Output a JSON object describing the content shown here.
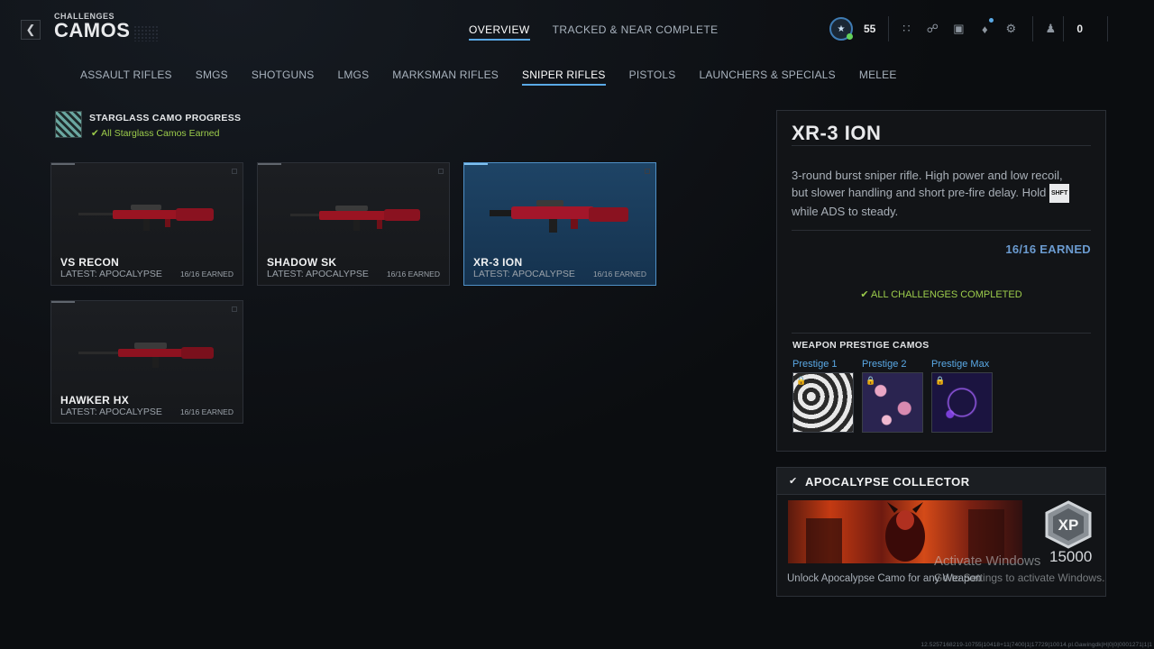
{
  "header": {
    "subtitle": "CHALLENGES",
    "title": "CAMOS",
    "tabs": [
      {
        "label": "OVERVIEW",
        "active": true
      },
      {
        "label": "TRACKED & NEAR COMPLETE",
        "active": false
      }
    ],
    "rank_level": "55",
    "currency_count": "0"
  },
  "categories": [
    {
      "label": "ASSAULT RIFLES",
      "active": false
    },
    {
      "label": "SMGS",
      "active": false
    },
    {
      "label": "SHOTGUNS",
      "active": false
    },
    {
      "label": "LMGS",
      "active": false
    },
    {
      "label": "MARKSMAN RIFLES",
      "active": false
    },
    {
      "label": "SNIPER RIFLES",
      "active": true
    },
    {
      "label": "PISTOLS",
      "active": false
    },
    {
      "label": "LAUNCHERS & SPECIALS",
      "active": false
    },
    {
      "label": "MELEE",
      "active": false
    }
  ],
  "starglass": {
    "title": "STARGLASS CAMO PROGRESS",
    "status": "All Starglass Camos Earned"
  },
  "weapons": [
    {
      "name": "VS RECON",
      "latest": "LATEST: APOCALYPSE",
      "earned": "16/16 EARNED",
      "selected": false
    },
    {
      "name": "SHADOW SK",
      "latest": "LATEST: APOCALYPSE",
      "earned": "16/16 EARNED",
      "selected": false
    },
    {
      "name": "XR-3 ION",
      "latest": "LATEST: APOCALYPSE",
      "earned": "16/16 EARNED",
      "selected": true
    },
    {
      "name": "HAWKER HX",
      "latest": "LATEST: APOCALYPSE",
      "earned": "16/16 EARNED",
      "selected": false
    }
  ],
  "detail": {
    "name": "XR-3 ION",
    "desc_part1": "3-round burst sniper rifle. High power and low recoil, but slower handling and short pre-fire delay. Hold",
    "key": "SHFT",
    "desc_part2": "while ADS to steady.",
    "earned": "16/16 EARNED",
    "complete": "ALL CHALLENGES COMPLETED",
    "prestige_header": "WEAPON PRESTIGE CAMOS",
    "prestige": [
      {
        "label": "Prestige 1"
      },
      {
        "label": "Prestige 2"
      },
      {
        "label": "Prestige Max"
      }
    ]
  },
  "collector": {
    "title": "APOCALYPSE COLLECTOR",
    "desc": "Unlock Apocalypse Camo for any Weapon",
    "xp_label": "XP",
    "xp_amount": "15000"
  },
  "watermark": {
    "line1": "Activate Windows",
    "line2": "Go to Settings to activate Windows."
  },
  "build_id": "12.5257168219-10755|10418+11|7400|1|17729|10014.pl.Gawingdk|H|0|0|0001271|1|1",
  "colors": {
    "accent_blue": "#5aa9e6",
    "success_green": "#9ccc4b",
    "camo_red": "#9a1422"
  }
}
